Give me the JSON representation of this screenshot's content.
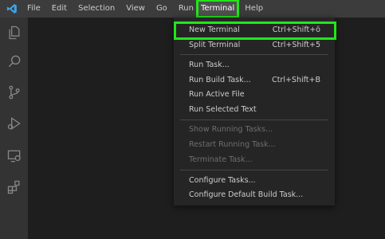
{
  "menubar": {
    "items": [
      {
        "label": "File"
      },
      {
        "label": "Edit"
      },
      {
        "label": "Selection"
      },
      {
        "label": "View"
      },
      {
        "label": "Go"
      },
      {
        "label": "Run"
      },
      {
        "label": "Terminal"
      },
      {
        "label": "Help"
      }
    ]
  },
  "activitybar": {
    "icons": [
      "explorer-icon",
      "search-icon",
      "source-control-icon",
      "run-debug-icon",
      "remote-explorer-icon",
      "extensions-icon"
    ]
  },
  "terminal_menu": {
    "items": [
      {
        "label": "New Terminal",
        "shortcut": "Ctrl+Shift+ö",
        "enabled": true
      },
      {
        "label": "Split Terminal",
        "shortcut": "Ctrl+Shift+5",
        "enabled": true
      },
      {
        "label": "Run Task...",
        "shortcut": "",
        "enabled": true
      },
      {
        "label": "Run Build Task...",
        "shortcut": "Ctrl+Shift+B",
        "enabled": true
      },
      {
        "label": "Run Active File",
        "shortcut": "",
        "enabled": true
      },
      {
        "label": "Run Selected Text",
        "shortcut": "",
        "enabled": true
      },
      {
        "label": "Show Running Tasks...",
        "shortcut": "",
        "enabled": false
      },
      {
        "label": "Restart Running Task...",
        "shortcut": "",
        "enabled": false
      },
      {
        "label": "Terminate Task...",
        "shortcut": "",
        "enabled": false
      },
      {
        "label": "Configure Tasks...",
        "shortcut": "",
        "enabled": true
      },
      {
        "label": "Configure Default Build Task...",
        "shortcut": "",
        "enabled": true
      }
    ]
  },
  "colors": {
    "highlight": "#22e619",
    "titlebar": "#3c3c3c",
    "activitybar": "#333333",
    "menu_bg": "#252526",
    "accent_logo": "#3ba4ec"
  }
}
